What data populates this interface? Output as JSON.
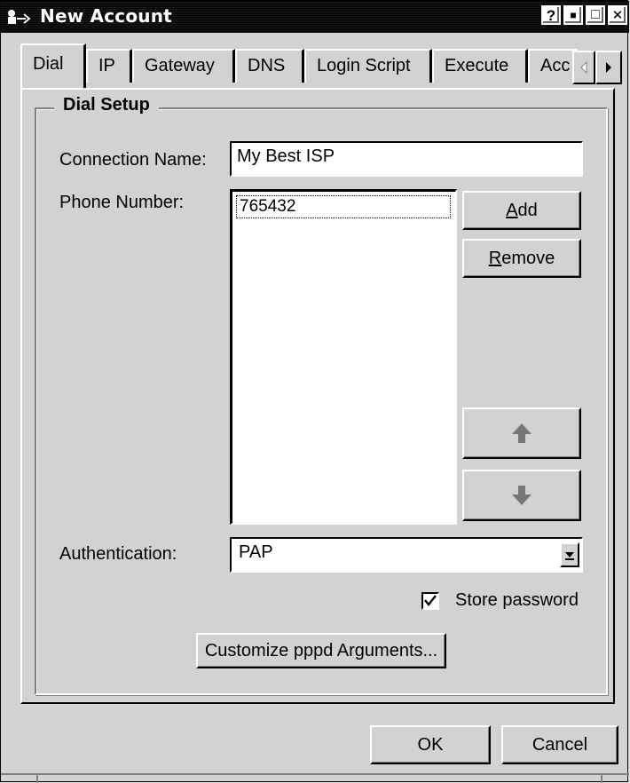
{
  "window": {
    "title": "New Account",
    "title_buttons": [
      "?",
      "■",
      "□",
      "✕"
    ]
  },
  "tabs": [
    {
      "label": "Dial",
      "active": true
    },
    {
      "label": "IP"
    },
    {
      "label": "Gateway"
    },
    {
      "label": "DNS"
    },
    {
      "label": "Login Script"
    },
    {
      "label": "Execute"
    },
    {
      "label": "Acc"
    }
  ],
  "group": {
    "legend": "Dial Setup"
  },
  "connection": {
    "label": "Connection Name:",
    "value": "My Best ISP"
  },
  "phone": {
    "label": "Phone Number:",
    "items": [
      "765432"
    ],
    "add_label_u": "A",
    "add_label_rest": "dd",
    "remove_label_u": "R",
    "remove_label_rest": "emove"
  },
  "auth": {
    "label": "Authentication:",
    "value": "PAP"
  },
  "store_password": {
    "label": "Store password",
    "checked": true
  },
  "customize": {
    "label": "Customize pppd Arguments..."
  },
  "footer": {
    "ok_label": "OK",
    "cancel_label": "Cancel"
  },
  "colors": {
    "titlebar": "#000000",
    "face": "#d2d2d2",
    "field": "#ffffff"
  },
  "icons": [
    "app-icon",
    "scroll-left-icon",
    "scroll-right-icon",
    "arrow-up-icon",
    "arrow-down-icon",
    "dropdown-arrow-icon",
    "checkmark-icon"
  ]
}
